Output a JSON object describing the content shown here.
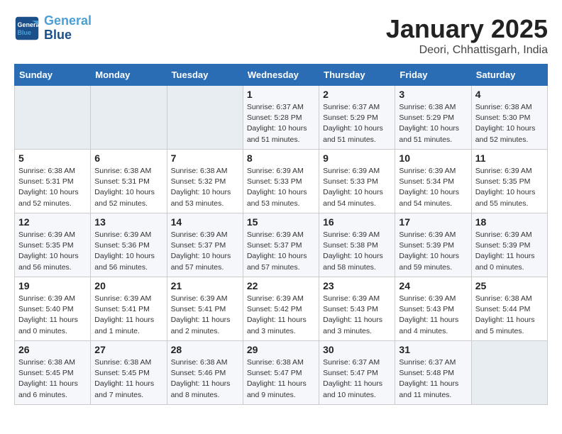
{
  "header": {
    "logo_line1": "General",
    "logo_line2": "Blue",
    "month": "January 2025",
    "location": "Deori, Chhattisgarh, India"
  },
  "weekdays": [
    "Sunday",
    "Monday",
    "Tuesday",
    "Wednesday",
    "Thursday",
    "Friday",
    "Saturday"
  ],
  "weeks": [
    [
      {
        "day": "",
        "info": ""
      },
      {
        "day": "",
        "info": ""
      },
      {
        "day": "",
        "info": ""
      },
      {
        "day": "1",
        "info": "Sunrise: 6:37 AM\nSunset: 5:28 PM\nDaylight: 10 hours\nand 51 minutes."
      },
      {
        "day": "2",
        "info": "Sunrise: 6:37 AM\nSunset: 5:29 PM\nDaylight: 10 hours\nand 51 minutes."
      },
      {
        "day": "3",
        "info": "Sunrise: 6:38 AM\nSunset: 5:29 PM\nDaylight: 10 hours\nand 51 minutes."
      },
      {
        "day": "4",
        "info": "Sunrise: 6:38 AM\nSunset: 5:30 PM\nDaylight: 10 hours\nand 52 minutes."
      }
    ],
    [
      {
        "day": "5",
        "info": "Sunrise: 6:38 AM\nSunset: 5:31 PM\nDaylight: 10 hours\nand 52 minutes."
      },
      {
        "day": "6",
        "info": "Sunrise: 6:38 AM\nSunset: 5:31 PM\nDaylight: 10 hours\nand 52 minutes."
      },
      {
        "day": "7",
        "info": "Sunrise: 6:38 AM\nSunset: 5:32 PM\nDaylight: 10 hours\nand 53 minutes."
      },
      {
        "day": "8",
        "info": "Sunrise: 6:39 AM\nSunset: 5:33 PM\nDaylight: 10 hours\nand 53 minutes."
      },
      {
        "day": "9",
        "info": "Sunrise: 6:39 AM\nSunset: 5:33 PM\nDaylight: 10 hours\nand 54 minutes."
      },
      {
        "day": "10",
        "info": "Sunrise: 6:39 AM\nSunset: 5:34 PM\nDaylight: 10 hours\nand 54 minutes."
      },
      {
        "day": "11",
        "info": "Sunrise: 6:39 AM\nSunset: 5:35 PM\nDaylight: 10 hours\nand 55 minutes."
      }
    ],
    [
      {
        "day": "12",
        "info": "Sunrise: 6:39 AM\nSunset: 5:35 PM\nDaylight: 10 hours\nand 56 minutes."
      },
      {
        "day": "13",
        "info": "Sunrise: 6:39 AM\nSunset: 5:36 PM\nDaylight: 10 hours\nand 56 minutes."
      },
      {
        "day": "14",
        "info": "Sunrise: 6:39 AM\nSunset: 5:37 PM\nDaylight: 10 hours\nand 57 minutes."
      },
      {
        "day": "15",
        "info": "Sunrise: 6:39 AM\nSunset: 5:37 PM\nDaylight: 10 hours\nand 57 minutes."
      },
      {
        "day": "16",
        "info": "Sunrise: 6:39 AM\nSunset: 5:38 PM\nDaylight: 10 hours\nand 58 minutes."
      },
      {
        "day": "17",
        "info": "Sunrise: 6:39 AM\nSunset: 5:39 PM\nDaylight: 10 hours\nand 59 minutes."
      },
      {
        "day": "18",
        "info": "Sunrise: 6:39 AM\nSunset: 5:39 PM\nDaylight: 11 hours\nand 0 minutes."
      }
    ],
    [
      {
        "day": "19",
        "info": "Sunrise: 6:39 AM\nSunset: 5:40 PM\nDaylight: 11 hours\nand 0 minutes."
      },
      {
        "day": "20",
        "info": "Sunrise: 6:39 AM\nSunset: 5:41 PM\nDaylight: 11 hours\nand 1 minute."
      },
      {
        "day": "21",
        "info": "Sunrise: 6:39 AM\nSunset: 5:41 PM\nDaylight: 11 hours\nand 2 minutes."
      },
      {
        "day": "22",
        "info": "Sunrise: 6:39 AM\nSunset: 5:42 PM\nDaylight: 11 hours\nand 3 minutes."
      },
      {
        "day": "23",
        "info": "Sunrise: 6:39 AM\nSunset: 5:43 PM\nDaylight: 11 hours\nand 3 minutes."
      },
      {
        "day": "24",
        "info": "Sunrise: 6:39 AM\nSunset: 5:43 PM\nDaylight: 11 hours\nand 4 minutes."
      },
      {
        "day": "25",
        "info": "Sunrise: 6:38 AM\nSunset: 5:44 PM\nDaylight: 11 hours\nand 5 minutes."
      }
    ],
    [
      {
        "day": "26",
        "info": "Sunrise: 6:38 AM\nSunset: 5:45 PM\nDaylight: 11 hours\nand 6 minutes."
      },
      {
        "day": "27",
        "info": "Sunrise: 6:38 AM\nSunset: 5:45 PM\nDaylight: 11 hours\nand 7 minutes."
      },
      {
        "day": "28",
        "info": "Sunrise: 6:38 AM\nSunset: 5:46 PM\nDaylight: 11 hours\nand 8 minutes."
      },
      {
        "day": "29",
        "info": "Sunrise: 6:38 AM\nSunset: 5:47 PM\nDaylight: 11 hours\nand 9 minutes."
      },
      {
        "day": "30",
        "info": "Sunrise: 6:37 AM\nSunset: 5:47 PM\nDaylight: 11 hours\nand 10 minutes."
      },
      {
        "day": "31",
        "info": "Sunrise: 6:37 AM\nSunset: 5:48 PM\nDaylight: 11 hours\nand 11 minutes."
      },
      {
        "day": "",
        "info": ""
      }
    ]
  ]
}
